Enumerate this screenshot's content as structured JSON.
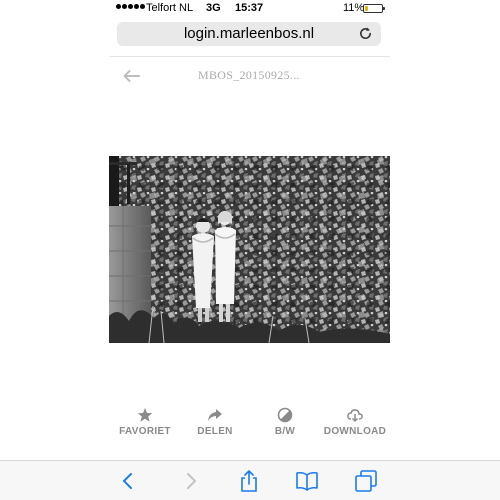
{
  "status_bar": {
    "carrier": "Telfort NL",
    "network": "3G",
    "time": "15:37",
    "battery_percent": "11%"
  },
  "browser": {
    "url": "login.marleenbos.nl"
  },
  "page": {
    "title": "MBOS_20150925..."
  },
  "actions": [
    {
      "label": "FAVORIET",
      "icon": "star-icon"
    },
    {
      "label": "DELEN",
      "icon": "share-arrow-icon"
    },
    {
      "label": "B/W",
      "icon": "contrast-icon"
    },
    {
      "label": "DOWNLOAD",
      "icon": "cloud-download-icon"
    }
  ],
  "toolbar": {
    "icons": [
      "back-icon",
      "forward-icon",
      "share-icon",
      "bookmarks-icon",
      "tabs-icon"
    ]
  },
  "colors": {
    "accent": "#1a7cf0",
    "action_gray": "#8a8a8a",
    "title_gray": "#aaaaaa",
    "url_bar_bg": "#e9e9ea"
  }
}
